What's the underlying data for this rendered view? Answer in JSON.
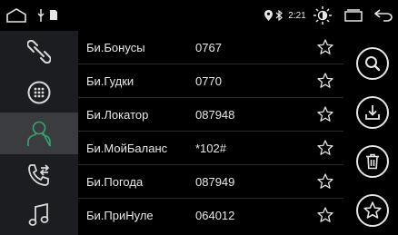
{
  "status": {
    "time": "2:21"
  },
  "sidebar": {
    "items": [
      {
        "icon": "link-icon"
      },
      {
        "icon": "dialpad-icon"
      },
      {
        "icon": "contacts-icon",
        "active": true
      },
      {
        "icon": "call-log-icon"
      },
      {
        "icon": "music-icon"
      }
    ]
  },
  "contacts": [
    {
      "name": "Би.Бонусы",
      "number": "0767"
    },
    {
      "name": "Би.Гудки",
      "number": "0770"
    },
    {
      "name": "Би.Локатор",
      "number": "087948"
    },
    {
      "name": "Би.МойБаланс",
      "number": "*102#"
    },
    {
      "name": "Би.Погода",
      "number": "087949"
    },
    {
      "name": "Би.ПриНуле",
      "number": "064012"
    }
  ],
  "actions": [
    {
      "icon": "search-icon"
    },
    {
      "icon": "download-icon"
    },
    {
      "icon": "delete-icon"
    },
    {
      "icon": "favorite-star-icon"
    }
  ]
}
